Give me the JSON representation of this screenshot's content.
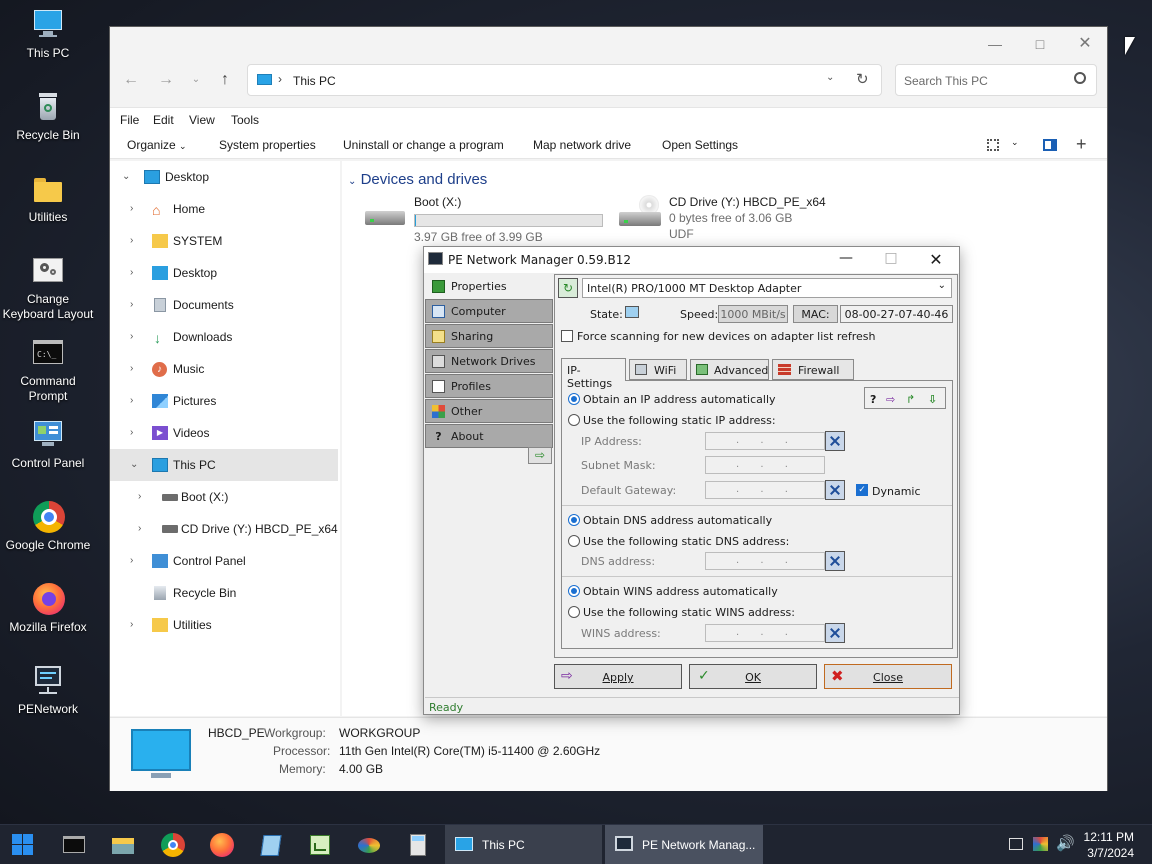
{
  "desktop": {
    "icons": [
      {
        "label": "This PC"
      },
      {
        "label": "Recycle Bin"
      },
      {
        "label": "Utilities"
      },
      {
        "label": "Change Keyboard Layout"
      },
      {
        "label": "Command Prompt"
      },
      {
        "label": "Control Panel"
      },
      {
        "label": "Google Chrome"
      },
      {
        "label": "Mozilla Firefox"
      },
      {
        "label": "PENetwork"
      }
    ]
  },
  "explorer": {
    "address": "This PC",
    "search_placeholder": "Search This PC",
    "menu": [
      "File",
      "Edit",
      "View",
      "Tools"
    ],
    "commands": [
      "Organize",
      "System properties",
      "Uninstall or change a program",
      "Map network drive",
      "Open Settings"
    ],
    "tree": [
      {
        "label": "Desktop"
      },
      {
        "label": "Home"
      },
      {
        "label": "SYSTEM"
      },
      {
        "label": "Desktop"
      },
      {
        "label": "Documents"
      },
      {
        "label": "Downloads"
      },
      {
        "label": "Music"
      },
      {
        "label": "Pictures"
      },
      {
        "label": "Videos"
      },
      {
        "label": "This PC"
      },
      {
        "label": "Boot (X:)"
      },
      {
        "label": "CD Drive (Y:) HBCD_PE_x64"
      },
      {
        "label": "Control Panel"
      },
      {
        "label": "Recycle Bin"
      },
      {
        "label": "Utilities"
      }
    ],
    "section_title": "Devices and drives",
    "drives": [
      {
        "name": "Boot (X:)",
        "free": "3.97 GB free of 3.99 GB",
        "used_fraction": 0.005
      },
      {
        "name": "CD Drive (Y:) HBCD_PE_x64",
        "free": "0 bytes free of 3.06 GB",
        "fs": "UDF"
      }
    ],
    "details": {
      "computer": "HBCD_PE",
      "workgroup_label": "Workgroup:",
      "workgroup": "WORKGROUP",
      "processor_label": "Processor:",
      "processor": "11th Gen Intel(R) Core(TM) i5-11400 @ 2.60GHz",
      "memory_label": "Memory:",
      "memory": "4.00 GB"
    }
  },
  "pe": {
    "title": "PE Network Manager 0.59.B12",
    "tabs": [
      "Properties",
      "Computer",
      "Sharing",
      "Network Drives",
      "Profiles",
      "Other",
      "About"
    ],
    "adapter": "Intel(R) PRO/1000 MT Desktop Adapter",
    "state_label": "State:",
    "speed_label": "Speed:",
    "speed": "1000 MBit/s",
    "mac_label": "MAC:",
    "mac": "08-00-27-07-40-46",
    "force_scan": "Force scanning for new devices on adapter list refresh",
    "inner_tabs": [
      "IP-Settings",
      "WiFi",
      "Advanced",
      "Firewall"
    ],
    "ip_auto": "Obtain an IP address automatically",
    "ip_static": "Use the following static IP address:",
    "ip_address": "IP Address:",
    "subnet": "Subnet Mask:",
    "gateway": "Default Gateway:",
    "dynamic": "Dynamic",
    "dns_auto": "Obtain DNS address automatically",
    "dns_static": "Use the following static DNS address:",
    "dns_address": "DNS address:",
    "wins_auto": "Obtain WINS address automatically",
    "wins_static": "Use the following static WINS address:",
    "wins_address": "WINS address:",
    "ip_placeholder": ". . .",
    "apply": "Apply",
    "ok": "OK",
    "close": "Close",
    "status": "Ready"
  },
  "taskbar": {
    "buttons": [
      "This PC",
      "PE Network Manag..."
    ],
    "time": "12:11 PM",
    "date": "3/7/2024"
  },
  "colors": {
    "accent": "#0067c0",
    "wallpaper": "#202634",
    "taskbar": "#1f2430"
  }
}
